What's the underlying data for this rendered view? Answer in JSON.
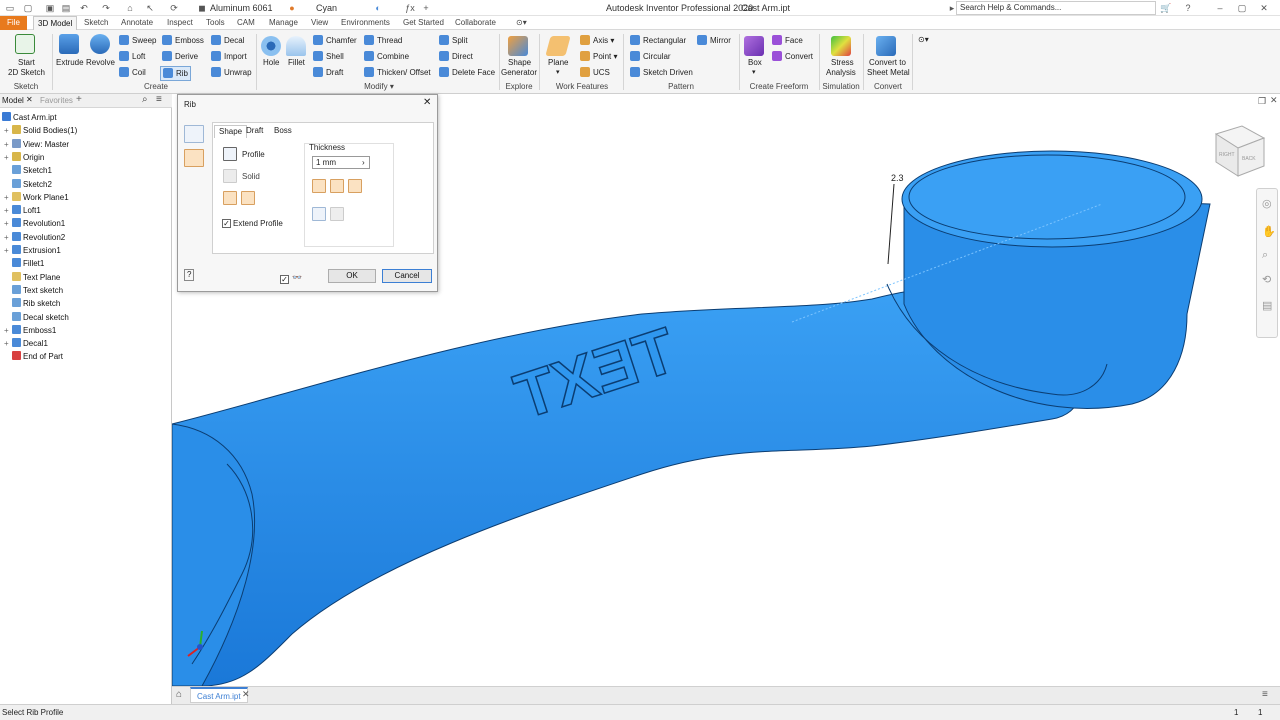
{
  "title_bar": {
    "app_title": "Autodesk Inventor Professional 2020",
    "doc_title": "Cast Arm.ipt",
    "material": "Aluminum 6061",
    "appearance": "Cyan",
    "search_placeholder": "Search Help & Commands..."
  },
  "menu": {
    "tabs": [
      "File",
      "3D Model",
      "Sketch",
      "Annotate",
      "Inspect",
      "Tools",
      "CAM",
      "Manage",
      "View",
      "Environments",
      "Get Started",
      "Collaborate"
    ],
    "active": "3D Model"
  },
  "ribbon": {
    "sketch": {
      "start": "Start",
      "sketch2d": "2D Sketch",
      "group": "Sketch"
    },
    "create": {
      "extrude": "Extrude",
      "revolve": "Revolve",
      "sweep": "Sweep",
      "loft": "Loft",
      "coil": "Coil",
      "emboss": "Emboss",
      "derive": "Derive",
      "rib": "Rib",
      "decal": "Decal",
      "import": "Import",
      "unwrap": "Unwrap",
      "group": "Create"
    },
    "modify": {
      "hole": "Hole",
      "fillet": "Fillet",
      "chamfer": "Chamfer",
      "shell": "Shell",
      "draft": "Draft",
      "thread": "Thread",
      "combine": "Combine",
      "thicken": "Thicken/ Offset",
      "split": "Split",
      "direct": "Direct",
      "delete_face": "Delete Face",
      "group": "Modify"
    },
    "explore": {
      "shape_gen_1": "Shape",
      "shape_gen_2": "Generator",
      "group": "Explore"
    },
    "work": {
      "plane": "Plane",
      "axis": "Axis",
      "point": "Point",
      "ucs": "UCS",
      "group": "Work Features"
    },
    "pattern": {
      "rectangular": "Rectangular",
      "circular": "Circular",
      "sketch_driven": "Sketch Driven",
      "mirror": "Mirror",
      "group": "Pattern"
    },
    "freeform": {
      "box": "Box",
      "face": "Face",
      "convert": "Convert",
      "group": "Create Freeform"
    },
    "simulation": {
      "stress_1": "Stress",
      "stress_2": "Analysis",
      "group": "Simulation"
    },
    "convert": {
      "sheet_1": "Convert to",
      "sheet_2": "Sheet Metal",
      "group": "Convert"
    }
  },
  "browser": {
    "tab_model": "Model",
    "tab_favorites": "Favorites",
    "items": [
      {
        "label": "Cast Arm.ipt",
        "plus": "",
        "color": "#3a7bd5"
      },
      {
        "label": "Solid Bodies(1)",
        "plus": "+",
        "color": "#d8b64a"
      },
      {
        "label": "View: Master",
        "plus": "+",
        "color": "#7a9ac8"
      },
      {
        "label": "Origin",
        "plus": "+",
        "color": "#d8b64a"
      },
      {
        "label": "Sketch1",
        "plus": "",
        "color": "#6aa0d8"
      },
      {
        "label": "Sketch2",
        "plus": "",
        "color": "#6aa0d8"
      },
      {
        "label": "Work Plane1",
        "plus": "+",
        "color": "#e0c060"
      },
      {
        "label": "Loft1",
        "plus": "+",
        "color": "#4a8ad8"
      },
      {
        "label": "Revolution1",
        "plus": "+",
        "color": "#4a8ad8"
      },
      {
        "label": "Revolution2",
        "plus": "+",
        "color": "#4a8ad8"
      },
      {
        "label": "Extrusion1",
        "plus": "+",
        "color": "#4a8ad8"
      },
      {
        "label": "Fillet1",
        "plus": "",
        "color": "#4a8ad8"
      },
      {
        "label": "Text Plane",
        "plus": "",
        "color": "#e0c060"
      },
      {
        "label": "Text sketch",
        "plus": "",
        "color": "#6aa0d8"
      },
      {
        "label": "Rib sketch",
        "plus": "",
        "color": "#6aa0d8"
      },
      {
        "label": "Decal sketch",
        "plus": "",
        "color": "#6aa0d8"
      },
      {
        "label": "Emboss1",
        "plus": "+",
        "color": "#4a8ad8"
      },
      {
        "label": "Decal1",
        "plus": "+",
        "color": "#4a8ad8"
      },
      {
        "label": "End of Part",
        "plus": "",
        "color": "#d84040"
      }
    ]
  },
  "dialog": {
    "title": "Rib",
    "tabs": [
      "Shape",
      "Draft",
      "Boss"
    ],
    "profile": "Profile",
    "solid": "Solid",
    "extend_profile": "Extend Profile",
    "thickness_label": "Thickness",
    "thickness_value": "1 mm",
    "ok": "OK",
    "cancel": "Cancel"
  },
  "viewport": {
    "dimension": "2.3",
    "emboss_text": "TEXT",
    "viewcube_right": "RIGHT",
    "viewcube_back": "BACK",
    "model_color": "#2a8ee8"
  },
  "doc_tab": "Cast Arm.ipt",
  "status": {
    "message": "Select Rib Profile",
    "count1": "1",
    "count2": "1"
  }
}
